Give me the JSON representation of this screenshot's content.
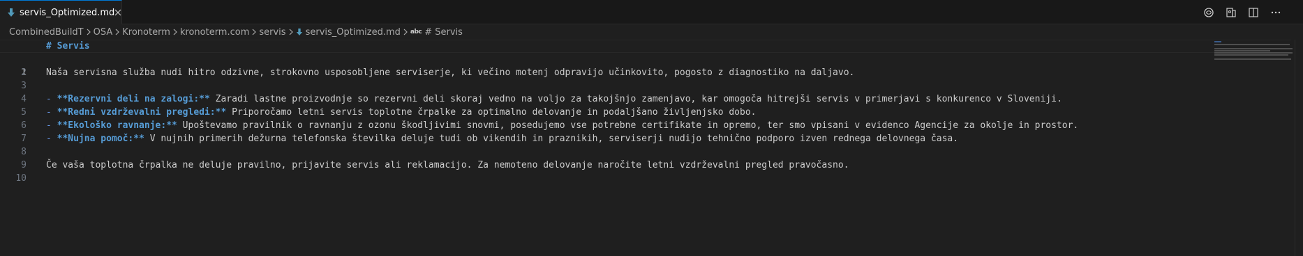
{
  "tab": {
    "label": "servis_Optimized.md",
    "icon": "markdown-icon"
  },
  "actions": [
    {
      "name": "copilot-chat-icon"
    },
    {
      "name": "open-preview-to-side-icon"
    },
    {
      "name": "split-editor-icon"
    },
    {
      "name": "more-actions-icon"
    }
  ],
  "breadcrumb": {
    "items": [
      "CombinedBuildT",
      "OSA",
      "Kronoterm",
      "kronoterm.com",
      "servis",
      "servis_Optimized.md",
      "# Servis"
    ],
    "symbol_prefix": "abc"
  },
  "editor": {
    "line_numbers": [
      "1",
      "2",
      "3",
      "4",
      "5",
      "6",
      "7",
      "8",
      "9",
      "10"
    ],
    "line1": "# Servis",
    "line3": "Naša servisna služba nudi hitro odzivne, strokovno usposobljene serviserje, ki večino motenj odpravijo učinkovito, pogosto z diagnostiko na daljavo.",
    "line5": {
      "dash": "- ",
      "bold": "**Rezervni deli na zalogi:**",
      "text": " Zaradi lastne proizvodnje so rezervni deli skoraj vedno na voljo za takojšnjo zamenjavo, kar omogoča hitrejši servis v primerjavi s konkurenco v Sloveniji."
    },
    "line6": {
      "dash": "- ",
      "bold": "**Redni vzdrževalni pregledi:**",
      "text": " Priporočamo letni servis toplotne črpalke za optimalno delovanje in podaljšano življenjsko dobo."
    },
    "line7": {
      "dash": "- ",
      "bold": "**Ekološko ravnanje:**",
      "text": " Upoštevamo pravilnik o ravnanju z ozonu škodljivimi snovmi, posedujemo vse potrebne certifikate in opremo, ter smo vpisani v evidenco Agencije za okolje in prostor."
    },
    "line8": {
      "dash": "- ",
      "bold": "**Nujna pomoč:**",
      "text": " V nujnih primerih dežurna telefonska številka deluje tudi ob vikendih in praznikih, serviserji nudijo tehnično podporo izven rednega delovnega časa."
    },
    "line10": "Če vaša toplotna črpalka ne deluje pravilno, prijavite servis ali reklamacijo. Za nemoteno delovanje naročite letni vzdrževalni pregled pravočasno."
  },
  "colors": {
    "background": "#1f1f1f",
    "heading": "#569cd6",
    "list_dash": "#6796e6",
    "text": "#cccccc",
    "line_number": "#6e7681",
    "accent": "#0078d4"
  }
}
